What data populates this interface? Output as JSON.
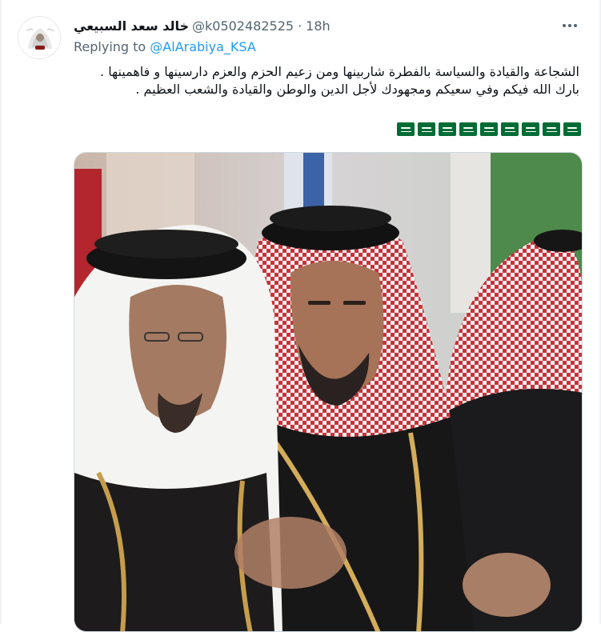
{
  "tweet": {
    "author_name": "خالد سعد السبيعي",
    "author_handle": "@k0502482525",
    "separator": "·",
    "timestamp": "18h",
    "replying_prefix": "Replying to",
    "replying_to": "@AlArabiya_KSA",
    "text_line1": "الشجاعة والقيادة والسياسة بالفطرة شاربينها ومن زعيم الحزم والعزم دارسينها و فاهمينها .",
    "text_line2": "بارك الله فيكم وفي سعيكم ومجهودك لأجل الدين والوطن والقيادة والشعب العظيم .",
    "emoji_flags": [
      "flag-saudi-arabia-icon",
      "flag-saudi-arabia-icon",
      "flag-saudi-arabia-icon",
      "flag-saudi-arabia-icon",
      "flag-saudi-arabia-icon",
      "flag-saudi-arabia-icon",
      "flag-saudi-arabia-icon",
      "flag-saudi-arabia-icon",
      "flag-saudi-arabia-icon"
    ]
  },
  "colors": {
    "link": "#1d9bf0",
    "secondary_text": "#536471",
    "flag_green": "#006c35"
  }
}
